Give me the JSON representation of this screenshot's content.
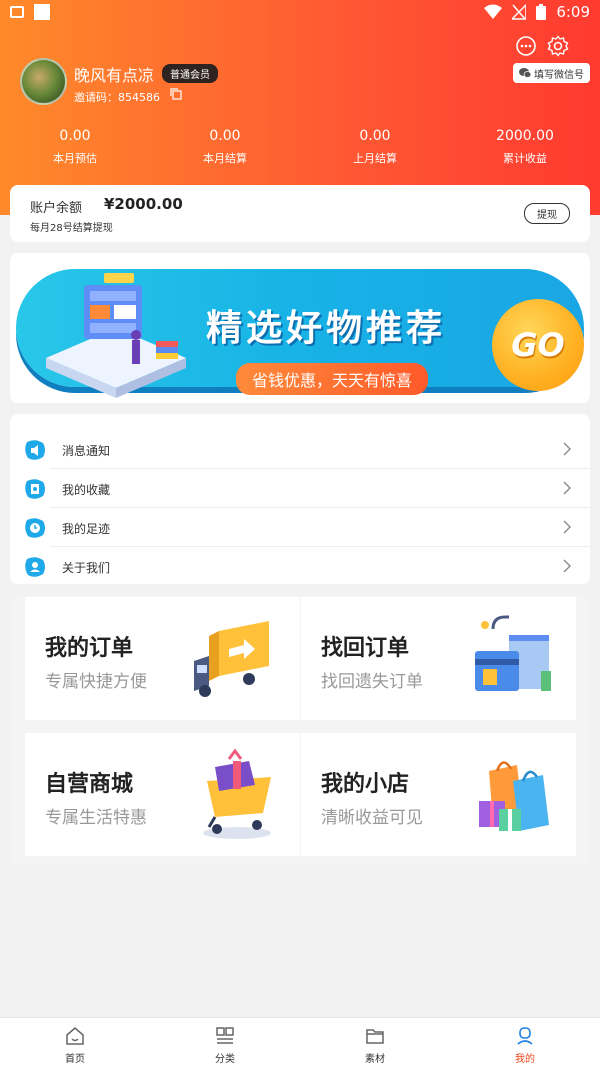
{
  "status_bar": {
    "time": "6:09"
  },
  "profile": {
    "username": "晚风有点凉",
    "member_level": "普通会员",
    "invite_code": "邀请码：854586"
  },
  "header_actions": {
    "wechat_label": "填写微信号"
  },
  "stats": [
    {
      "value": "0.00",
      "label": "本月预估"
    },
    {
      "value": "0.00",
      "label": "本月结算"
    },
    {
      "value": "0.00",
      "label": "上月结算"
    },
    {
      "value": "2000.00",
      "label": "累计收益"
    }
  ],
  "balance": {
    "label": "账户余额",
    "amount": "¥2000.00",
    "note": "每月28号结算提现",
    "withdraw_label": "提现"
  },
  "banner": {
    "title": "精选好物推荐",
    "subtitle": "省钱优惠，天天有惊喜",
    "go_label": "GO"
  },
  "menu": [
    {
      "label": "消息通知",
      "icon": "speaker-icon"
    },
    {
      "label": "我的收藏",
      "icon": "star-bookmark-icon"
    },
    {
      "label": "我的足迹",
      "icon": "clock-icon"
    },
    {
      "label": "关于我们",
      "icon": "user-icon"
    }
  ],
  "tiles": [
    {
      "title": "我的订单",
      "subtitle": "专属快捷方便",
      "icon": "delivery-truck-icon"
    },
    {
      "title": "找回订单",
      "subtitle": "找回遗失订单",
      "icon": "bank-card-icon"
    },
    {
      "title": "自营商城",
      "subtitle": "专属生活特惠",
      "icon": "shopping-cart-icon"
    },
    {
      "title": "我的小店",
      "subtitle": "清晰收益可见",
      "icon": "shopping-bags-icon"
    }
  ],
  "bottom_nav": [
    {
      "label": "首页",
      "icon": "home-icon",
      "active": false
    },
    {
      "label": "分类",
      "icon": "grid-icon",
      "active": false
    },
    {
      "label": "素材",
      "icon": "folder-icon",
      "active": false
    },
    {
      "label": "我的",
      "icon": "profile-icon",
      "active": true
    }
  ],
  "colors": {
    "accent": "#f0461e",
    "header_start": "#ff8a2a",
    "header_end": "#ff3a30",
    "banner_blue": "#17b2e6"
  }
}
